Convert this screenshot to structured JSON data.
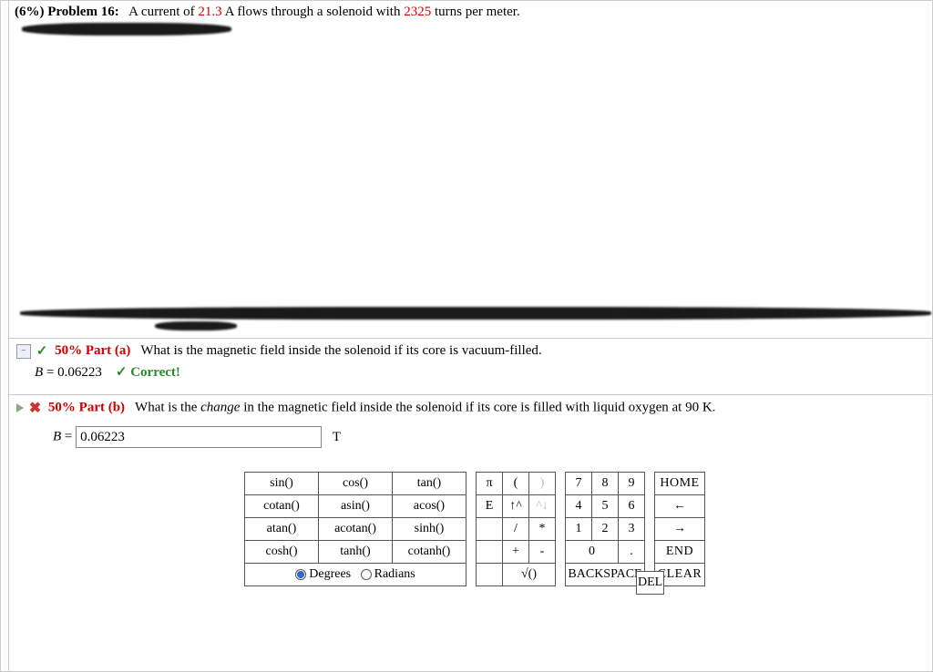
{
  "header": {
    "weight": "(6%)",
    "problem_label": "Problem 16:",
    "stem_pre": "A current of ",
    "current": "21.3",
    "stem_mid": " A flows through a solenoid with ",
    "turns": "2325",
    "stem_post": " turns per meter."
  },
  "part_a": {
    "weight": "50%",
    "label": "Part (a)",
    "question": "What is the magnetic field inside the solenoid if its core is vacuum-filled.",
    "var": "B",
    "equals": " = ",
    "value": "0.06223",
    "correct_mark": "✓",
    "correct_text": "Correct!"
  },
  "part_b": {
    "weight": "50%",
    "label": "Part (b)",
    "q_pre": "What is the ",
    "q_em": "change",
    "q_post": " in the magnetic field inside the solenoid if its core is filled with liquid oxygen at 90 K.",
    "var": "B",
    "equals": " = ",
    "input_value": "0.06223",
    "unit": "T"
  },
  "keypad": {
    "functions": [
      [
        "sin()",
        "cos()",
        "tan()"
      ],
      [
        "cotan()",
        "asin()",
        "acos()"
      ],
      [
        "atan()",
        "acotan()",
        "sinh()"
      ],
      [
        "cosh()",
        "tanh()",
        "cotanh()"
      ]
    ],
    "angle_mode": {
      "degrees": "Degrees",
      "radians": "Radians",
      "selected": "degrees"
    },
    "symbols": [
      [
        "π",
        "(",
        ")"
      ],
      [
        "E",
        "↑^",
        "^↓"
      ],
      [
        "",
        "/",
        "*"
      ],
      [
        "",
        "+",
        "-"
      ],
      [
        "",
        "√()",
        ""
      ]
    ],
    "numbers": [
      [
        "7",
        "8",
        "9"
      ],
      [
        "4",
        "5",
        "6"
      ],
      [
        "1",
        "2",
        "3"
      ],
      [
        "0",
        "."
      ]
    ],
    "controls": [
      "HOME",
      "←",
      "→",
      "END",
      "CLEAR"
    ],
    "backspace": "BACKSPACE",
    "del": "DEL"
  }
}
